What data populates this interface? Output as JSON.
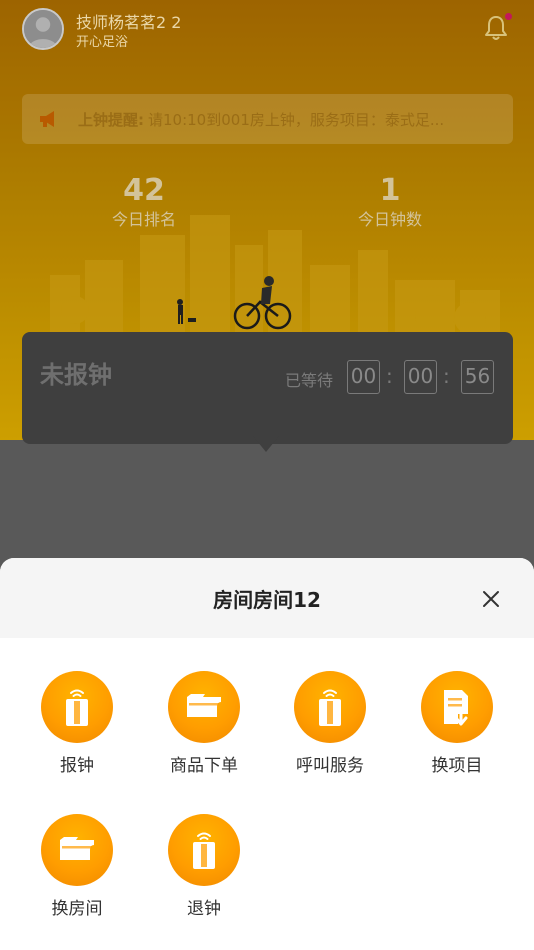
{
  "header": {
    "user_name": "技师杨茗茗2 2",
    "shop_name": "开心足浴",
    "notification_icon": "bell-icon",
    "notification_badge_color": "#c2185b"
  },
  "notice": {
    "icon": "megaphone-icon",
    "label": "上钟提醒:",
    "text": "请10:10到001房上钟，服务项目：泰式足..."
  },
  "stats": {
    "rank_value": "42",
    "rank_label": "今日排名",
    "count_value": "1",
    "count_label": "今日钟数"
  },
  "status_card": {
    "title": "未报钟",
    "wait_label": "已等待",
    "timer": {
      "hours": "00",
      "minutes": "00",
      "seconds": "56"
    }
  },
  "sheet": {
    "title": "房间房间12",
    "close_icon": "close-icon",
    "actions": [
      {
        "label": "报钟",
        "icon": "door-icon"
      },
      {
        "label": "商品下单",
        "icon": "ticket-icon"
      },
      {
        "label": "呼叫服务",
        "icon": "door-icon"
      },
      {
        "label": "换项目",
        "icon": "document-download-icon"
      },
      {
        "label": "换房间",
        "icon": "ticket-icon"
      },
      {
        "label": "退钟",
        "icon": "door-icon"
      }
    ]
  },
  "colors": {
    "accent": "#ff9d00",
    "header_gradient_top": "#a66a00",
    "header_gradient_bottom": "#d8a800",
    "overlay": "#595959",
    "sheet_header_bg": "#f5f5f5"
  }
}
